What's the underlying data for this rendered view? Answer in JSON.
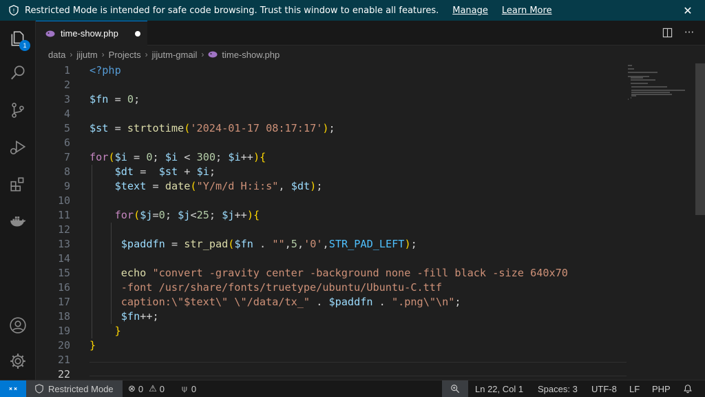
{
  "banner": {
    "message": "Restricted Mode is intended for safe code browsing. Trust this window to enable all features.",
    "manage_label": "Manage",
    "learn_more_label": "Learn More"
  },
  "activity_bar": {
    "explorer_badge": "1"
  },
  "tab": {
    "file_name": "time-show.php"
  },
  "breadcrumb": [
    "data",
    "jijutm",
    "Projects",
    "jijutm-gmail",
    "time-show.php"
  ],
  "editor": {
    "line_numbers": [
      "1",
      "2",
      "3",
      "4",
      "5",
      "6",
      "7",
      "8",
      "9",
      "10",
      "11",
      "12",
      "13",
      "14",
      "15",
      "16",
      "17",
      "18",
      "19",
      "20",
      "21",
      "22"
    ],
    "active_line": "22",
    "lines": [
      "<?php",
      "",
      "$fn = 0;",
      "",
      "$st = strtotime('2024-01-17 08:17:17');",
      "",
      "for($i = 0; $i < 300; $i++){",
      "    $dt =  $st + $i;",
      "    $text = date(\"Y/m/d H:i:s\", $dt);",
      "",
      "    for($j=0; $j<25; $j++){",
      "",
      "     $paddfn = str_pad($fn . \"\",5,'0',STR_PAD_LEFT);",
      "",
      "     echo \"convert -gravity center -background none -fill black -size 640x70",
      "     -font /usr/share/fonts/truetype/ubuntu/Ubuntu-C.ttf",
      "     caption:\\\"$text\\\" \\\"/data/tx_\" . $paddfn . \".png\\\"\\n\";",
      "     $fn++;",
      "    }",
      "}",
      "",
      ""
    ]
  },
  "status_bar": {
    "restricted_mode": "Restricted Mode",
    "errors": "0",
    "warnings": "0",
    "ports": "0",
    "cursor_position": "Ln 22, Col 1",
    "indentation": "Spaces: 3",
    "encoding": "UTF-8",
    "eol": "LF",
    "language": "PHP"
  },
  "colors": {
    "banner": "#063b49",
    "accent": "#0078d4",
    "editor_bg": "#1f1f1f"
  }
}
